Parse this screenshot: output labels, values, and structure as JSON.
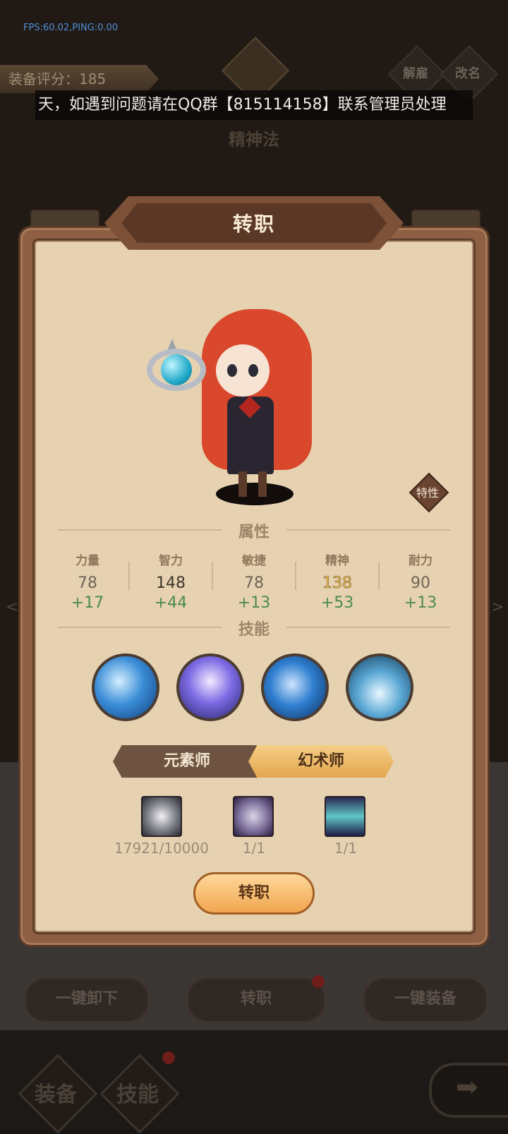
{
  "debug": {
    "fps_text": "FPS:60.02,PING:0.00"
  },
  "header": {
    "rating_label": "装备评分：185",
    "dismiss_label": "解雇",
    "rename_label": "改名",
    "notice": "天，如遇到问题请在QQ群【815114158】联系管理员处理",
    "subtitle": "精神法"
  },
  "modal": {
    "title": "转职",
    "trait_label": "特性",
    "attributes_label": "属性",
    "skills_label": "技能",
    "stats": [
      {
        "name": "力量",
        "base": "78",
        "bonus": "+17"
      },
      {
        "name": "智力",
        "base": "148",
        "bonus": "+44"
      },
      {
        "name": "敏捷",
        "base": "78",
        "bonus": "+13"
      },
      {
        "name": "精神",
        "base": "138",
        "bonus": "+53"
      },
      {
        "name": "耐力",
        "base": "90",
        "bonus": "+13"
      }
    ],
    "skills": [
      "lightning-skill-icon",
      "dash-skill-icon",
      "ice-shard-skill-icon",
      "frost-burst-skill-icon"
    ],
    "class_tabs": [
      {
        "label": "元素师",
        "selected": false
      },
      {
        "label": "幻术师",
        "selected": true
      }
    ],
    "materials": [
      {
        "icon": "silver-coin-icon",
        "count": "17921/10000"
      },
      {
        "icon": "stone-icon",
        "count": "1/1"
      },
      {
        "icon": "robe-icon",
        "count": "1/1"
      }
    ],
    "confirm_label": "转职"
  },
  "bottom": {
    "unequip_all": "一键卸下",
    "job_change": "转职",
    "equip_all": "一键装备",
    "tab_equipment": "装备",
    "tab_skills": "技能"
  },
  "colors": {
    "modal_bg": "#e6d2b1",
    "frame": "#8e5f43",
    "bonus_green": "#4b8a50",
    "selected_tab": "#f0b660"
  }
}
